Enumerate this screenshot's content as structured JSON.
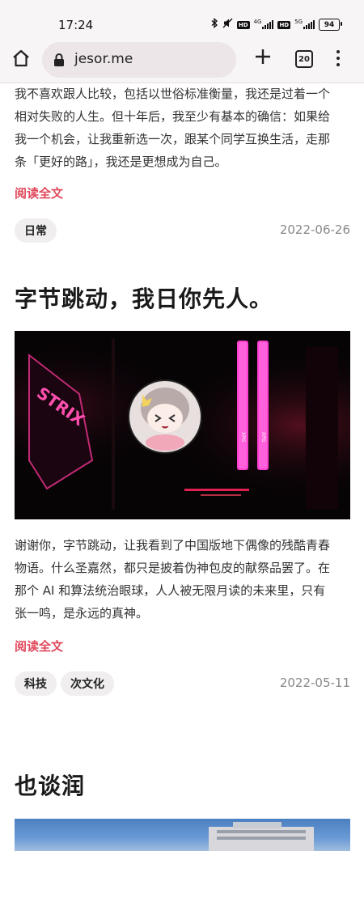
{
  "status_bar": {
    "time": "17:24",
    "network_1": "4G",
    "network_2": "5G",
    "hd_label": "HD",
    "battery": "94"
  },
  "browser": {
    "url": "jesor.me",
    "tab_count": "20",
    "home_icon": "home-icon",
    "plus_icon": "plus-icon",
    "menu_icon": "more-vert-icon"
  },
  "posts": [
    {
      "excerpt": "我不喜欢跟人比较，包括以世俗标准衡量，我还是过着一个相对失败的人生。但十年后，我至少有基本的确信：如果给我一个机会，让我重新选一次，跟某个同学互换生活，走那条「更好的路」，我还是更想成为自己。",
      "excerpt_lines": [
        "我不喜欢跟人比较，包括以世俗标准衡量，我还是过着一个",
        "相对失败的人生。但十年后，我至少有基本的确信：如果给",
        "我一个机会，让我重新选一次，跟某个同学互换生活，走那",
        "条「更好的路」，我还是更想成为自己。"
      ],
      "read_more": "阅读全文",
      "tags": [
        "日常"
      ],
      "date": "2022-06-26"
    },
    {
      "title": "字节跳动，我日你先人。",
      "excerpt_lines": [
        "谢谢你，字节跳动，让我看到了中国版地下偶像的残酷青春",
        "物语。什么圣嘉然，都只是披着伪神包皮的献祭品罢了。在",
        "那个 AI 和算法统治眼球，人人被无限月读的未来里，只有",
        "张一鸣，是永远的真神。"
      ],
      "read_more": "阅读全文",
      "tags": [
        "科技",
        "次文化"
      ],
      "date": "2022-05-11"
    },
    {
      "title": "也谈润"
    }
  ],
  "colors": {
    "accent": "#e0475a",
    "date": "#888888",
    "tag_bg": "#f0eeee"
  }
}
